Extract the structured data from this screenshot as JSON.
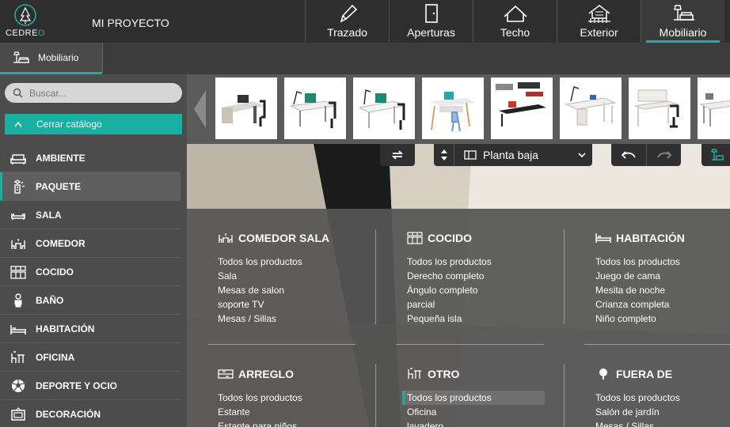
{
  "app": {
    "logo_text_main": "CEDRE",
    "logo_text_accent": "O",
    "project_title": "MI PROYECTO"
  },
  "nav": [
    {
      "id": "trazado",
      "label": "Trazado",
      "icon": "pencil-icon"
    },
    {
      "id": "aperturas",
      "label": "Aperturas",
      "icon": "door-icon"
    },
    {
      "id": "techo",
      "label": "Techo",
      "icon": "roof-icon"
    },
    {
      "id": "exterior",
      "label": "Exterior",
      "icon": "house-exterior-icon"
    },
    {
      "id": "mobiliario",
      "label": "Mobiliario",
      "icon": "furniture-lamp-icon",
      "active": true
    }
  ],
  "subbar": {
    "tab_label": "Mobiliario"
  },
  "sidebar": {
    "search_placeholder": "Buscar...",
    "close_catalog_label": "Cerrar catálogo",
    "categories": [
      {
        "label": "AMBIENTE",
        "icon": "armchair-icon"
      },
      {
        "label": "PAQUETE",
        "icon": "package-icon",
        "active": true
      },
      {
        "label": "SALA",
        "icon": "sofa-icon"
      },
      {
        "label": "COMEDOR",
        "icon": "dining-table-icon"
      },
      {
        "label": "COCIDO",
        "icon": "kitchen-icon"
      },
      {
        "label": "BAÑO",
        "icon": "bathroom-icon"
      },
      {
        "label": "HABITACIÓN",
        "icon": "bed-icon"
      },
      {
        "label": "OFICINA",
        "icon": "office-chair-icon"
      },
      {
        "label": "DEPORTE Y OCIO",
        "icon": "ball-icon"
      },
      {
        "label": "DECORACIÓN",
        "icon": "picture-frame-icon"
      }
    ]
  },
  "toolbar": {
    "floor_label": "Planta baja"
  },
  "catalog": {
    "columns": [
      {
        "title": "COMEDOR SALA",
        "icon": "dining-table-icon",
        "items": [
          "Todos los productos",
          "Sala",
          "Mesas de salon",
          "soporte TV",
          "Mesas / Sillas"
        ]
      },
      {
        "title": "COCIDO",
        "icon": "kitchen-icon",
        "items": [
          "Todos los productos",
          "Derecho completo",
          "Ángulo completo",
          "parcial",
          "Pequeña isla"
        ]
      },
      {
        "title": "HABITACIÓN",
        "icon": "bed-icon",
        "items": [
          "Todos los productos",
          "Juego de cama",
          "Mesita de noche",
          "Crianza completa",
          "Niño completo"
        ]
      },
      {
        "title": "ARREGLO",
        "icon": "storage-icon",
        "items": [
          "Todos los productos",
          "Estante",
          "Estante para niños"
        ]
      },
      {
        "title": "OTRO",
        "icon": "office-chair-icon",
        "items": [
          "Todos los productos",
          "Oficina",
          "lavadero"
        ],
        "highlight": 0
      },
      {
        "title": "FUERA DE",
        "icon": "tree-icon",
        "items": [
          "Todos los productos",
          "Salón de jardín",
          "Mesas / Sillas"
        ]
      }
    ]
  },
  "colors": {
    "accent": "#19b0a2",
    "topbar": "#2e2e2e",
    "sidebar": "#4c4c4c",
    "panel": "#555555"
  }
}
